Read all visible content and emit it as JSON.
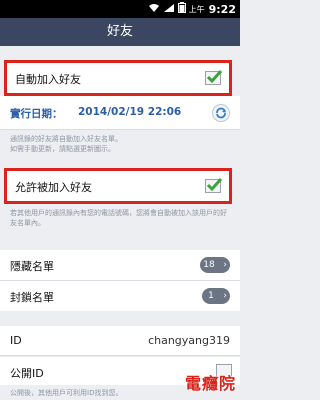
{
  "status_bar": {
    "ampm": "上午",
    "time": "9:22",
    "icons": [
      "wifi-icon",
      "signal-icon",
      "battery-icon"
    ]
  },
  "header": {
    "title": "好友"
  },
  "auto_add": {
    "label": "自動加入好友",
    "checked": true
  },
  "execution": {
    "label": "實行日期：",
    "value": "2014/02/19 22:06"
  },
  "auto_add_hint": "通訊錄的好友將自動加入好友名單。\n如需手動更新，請點選更新圖示。",
  "allow_add": {
    "label": "允許被加入好友",
    "checked": true
  },
  "allow_add_hint": "若其他用戶的通訊錄內有您的電話號碼，您將會自動被加入該用戶的好友名單內。",
  "hidden_list": {
    "label": "隱藏名單",
    "count": "18"
  },
  "blocked_list": {
    "label": "封鎖名單",
    "count": "1"
  },
  "id_row": {
    "label": "ID",
    "value": "changyang319"
  },
  "public_id": {
    "label": "公開ID",
    "checked": false
  },
  "public_id_hint": "公開後，其他用戶可利用ID找到您。",
  "watermark": "電癮院",
  "colors": {
    "accent_red": "#d9231b",
    "header_bg": "#3b4760",
    "date_blue": "#2a5ea8"
  }
}
